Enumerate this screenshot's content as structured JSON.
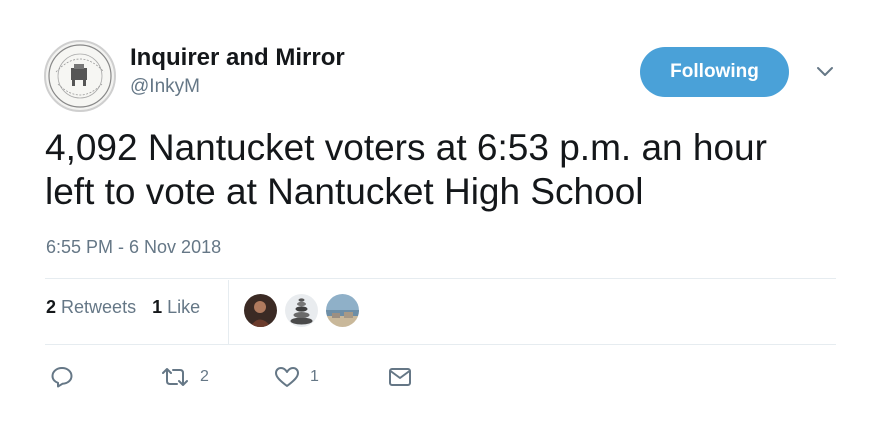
{
  "author": {
    "name": "Inquirer and Mirror",
    "handle": "@InkyM",
    "avatar_icon": "newspaper-seal-logo"
  },
  "follow_button": {
    "label": "Following",
    "color": "#4aa1d8"
  },
  "tweet": {
    "lines": [
      "4,092 Nantucket voters at 6:53 p.m. an hour",
      "left to vote at Nantucket High School"
    ],
    "timestamp": "6:55 PM - 6 Nov 2018"
  },
  "stats": {
    "retweets_count": "2",
    "retweets_label": "Retweets",
    "likes_count": "1",
    "likes_label": "Like"
  },
  "likers": [
    {
      "icon": "user-avatar-portrait"
    },
    {
      "icon": "user-avatar-stones"
    },
    {
      "icon": "user-avatar-landscape"
    }
  ],
  "actions": {
    "reply_icon": "reply-icon",
    "retweet_icon": "retweet-icon",
    "retweet_count": "2",
    "like_icon": "heart-icon",
    "like_count": "1",
    "message_icon": "envelope-icon"
  }
}
